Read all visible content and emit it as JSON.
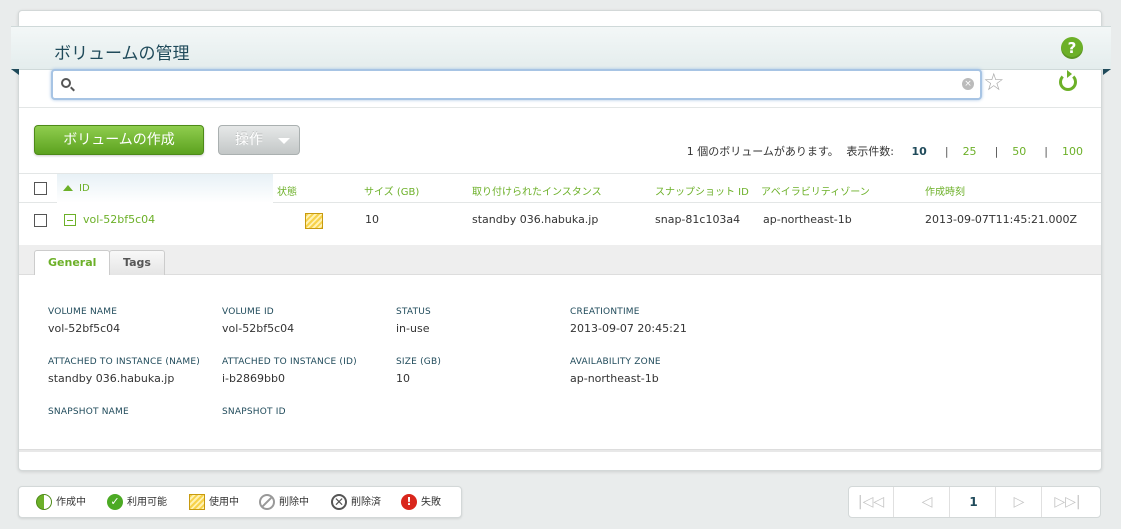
{
  "header": {
    "title": "ボリュームの管理",
    "help_icon": "?"
  },
  "search": {
    "value": "",
    "placeholder": ""
  },
  "toolbar": {
    "create_label": "ボリュームの作成",
    "actions_label": "操作"
  },
  "summary": {
    "count_text": "1 個のボリュームがあります。",
    "per_page_label": "表示件数:",
    "page_sizes": [
      "10",
      "25",
      "50",
      "100"
    ],
    "active_page_size": "10",
    "separator": "|"
  },
  "table": {
    "columns": [
      "ID",
      "状態",
      "サイズ (GB)",
      "取り付けられたインスタンス",
      "スナップショット ID",
      "アベイラビリティゾーン",
      "作成時刻"
    ],
    "rows": [
      {
        "id": "vol-52bf5c04",
        "status": "in-use",
        "size": "10",
        "instance": "standby 036.habuka.jp",
        "snapshot": "snap-81c103a4",
        "zone": "ap-northeast-1b",
        "created": "2013-09-07T11:45:21.000Z"
      }
    ]
  },
  "detail": {
    "tabs": [
      "General",
      "Tags"
    ],
    "active_tab": "General",
    "fields": {
      "volume_name": {
        "label": "VOLUME NAME",
        "value": "vol-52bf5c04"
      },
      "volume_id": {
        "label": "VOLUME ID",
        "value": "vol-52bf5c04"
      },
      "status": {
        "label": "STATUS",
        "value": "in-use"
      },
      "creation_time": {
        "label": "CREATIONTIME",
        "value": "2013-09-07 20:45:21"
      },
      "attached_name": {
        "label": "ATTACHED TO INSTANCE (NAME)",
        "value": "standby 036.habuka.jp"
      },
      "attached_id": {
        "label": "ATTACHED TO INSTANCE (ID)",
        "value": "i-b2869bb0"
      },
      "size": {
        "label": "SIZE (GB)",
        "value": "10"
      },
      "zone": {
        "label": "AVAILABILITY ZONE",
        "value": "ap-northeast-1b"
      },
      "snapshot_name": {
        "label": "SNAPSHOT NAME",
        "value": ""
      },
      "snapshot_id": {
        "label": "SNAPSHOT ID",
        "value": ""
      }
    }
  },
  "legend": {
    "items": [
      {
        "label": "作成中",
        "icon": "creating-icon"
      },
      {
        "label": "利用可能",
        "icon": "available-icon",
        "glyph": "✓"
      },
      {
        "label": "使用中",
        "icon": "in-use-icon"
      },
      {
        "label": "削除中",
        "icon": "deleting-icon"
      },
      {
        "label": "削除済",
        "icon": "deleted-icon",
        "glyph": "✕"
      },
      {
        "label": "失敗",
        "icon": "failed-icon",
        "glyph": "!"
      }
    ]
  },
  "pager": {
    "first": "|◁◁",
    "prev": "◁",
    "current": "1",
    "next": "▷",
    "last": "▷▷|"
  },
  "colors": {
    "accent": "#6cb028",
    "title": "#1f4a5a",
    "in_use": "#f7d24a",
    "failed": "#d9261c"
  }
}
